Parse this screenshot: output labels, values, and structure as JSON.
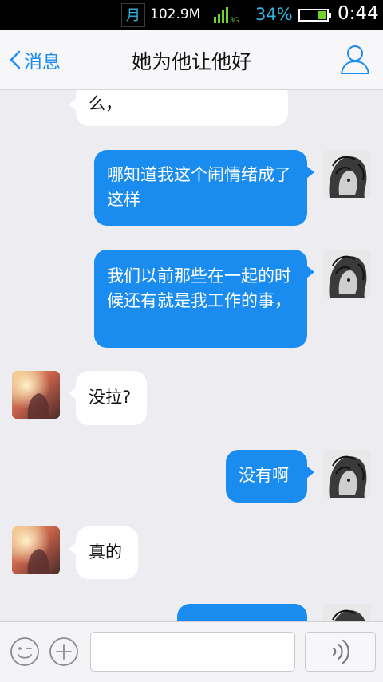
{
  "status_bar": {
    "moon_glyph": "月",
    "net_speed": "102.9M",
    "network_type": "3G",
    "battery_percent": "34%",
    "battery_level": 0.34,
    "time": "0:44",
    "accent_color": "#33b5e5"
  },
  "nav": {
    "back_label": "消息",
    "title": "她为他让他好",
    "profile_icon": "person-icon"
  },
  "messages": [
    {
      "side": "in",
      "text": "么，",
      "avatar": "avatar-her"
    },
    {
      "side": "out",
      "text": "哪知道我这个闹情绪成了这样",
      "avatar": "avatar-me"
    },
    {
      "side": "out",
      "text": "我们以前那些在一起的时候还有就是我工作的事，",
      "avatar": "avatar-me"
    },
    {
      "side": "in",
      "text": "没拉?",
      "avatar": "avatar-her"
    },
    {
      "side": "out",
      "text": "没有啊",
      "avatar": "avatar-me"
    },
    {
      "side": "in",
      "text": "真的",
      "avatar": "avatar-her"
    },
    {
      "side": "out",
      "text": "",
      "avatar": "avatar-me"
    }
  ],
  "input_bar": {
    "emoji_icon": "emoji-icon",
    "plus_icon": "plus-icon",
    "text_value": "",
    "voice_icon": "voice-icon"
  },
  "colors": {
    "outgoing_bubble": "#1a8cf0",
    "incoming_bubble": "#ffffff",
    "chat_background": "#ececf1",
    "link_blue": "#1b8cf5"
  }
}
